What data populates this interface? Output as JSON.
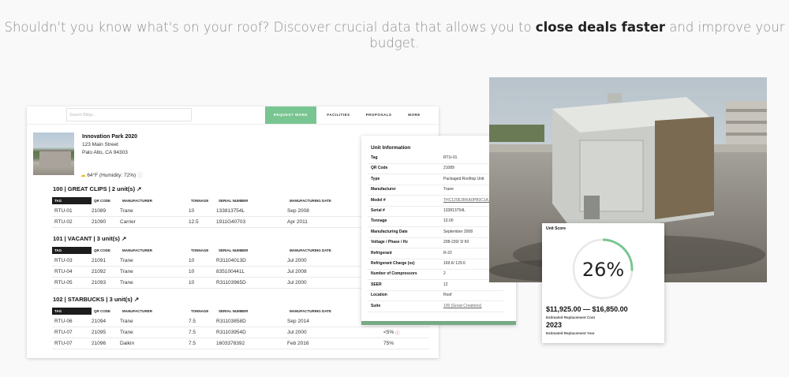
{
  "headline": {
    "pre": "Shouldn't you know what's on your roof? Discover crucial data that allows you to ",
    "bold": "close deals faster",
    "post": " and improve your budget."
  },
  "app": {
    "search_placeholder": "Search Bldgs...",
    "nav": [
      "REQUEST WORK",
      "FACILITIES",
      "PROPOSALS",
      "MORE"
    ],
    "building": {
      "name": "Innovation Park 2020",
      "address1": "123 Main Street",
      "address2": "Palo Alto, CA 94303",
      "weather": "64°F (Humidity: 72%)"
    },
    "table_headers": [
      "TAG",
      "QR CODE",
      "MANUFACTURER",
      "TONNAGE",
      "SERIAL NUMBER",
      "MANUFACTURING DATE"
    ],
    "groups": [
      {
        "title": "100 | GREAT CLIPS | 2 unit(s) ↗",
        "rows": [
          [
            "RTU-01",
            "21089",
            "Trane",
            "10",
            "133813754L",
            "Sep 2008",
            ""
          ],
          [
            "RTU-02",
            "21090",
            "Carrier",
            "12.5",
            "1911G40703",
            "Apr 2011",
            ""
          ]
        ]
      },
      {
        "title": "101 | VACANT | 3 unit(s) ↗",
        "rows": [
          [
            "RTU-03",
            "21091",
            "Trane",
            "10",
            "R31104013D",
            "Jul 2000",
            ""
          ],
          [
            "RTU-04",
            "21092",
            "Trane",
            "10",
            "835100441L",
            "Jul 2008",
            ""
          ],
          [
            "RTU-05",
            "21093",
            "Trane",
            "10",
            "R31103965D",
            "Jul 2000",
            ""
          ]
        ]
      },
      {
        "title": "102 | STARBUCKS | 3 unit(s) ↗",
        "rows": [
          [
            "RTU-06",
            "21094",
            "Trane",
            "7.5",
            "R31103858D",
            "Sep 2014",
            ""
          ],
          [
            "RTU-07",
            "21095",
            "Trane",
            "7.5",
            "R31103954D",
            "Jul 2000",
            "<5%"
          ],
          [
            "RTU-07",
            "21096",
            "Daikin",
            "7.5",
            "1603378392",
            "Feb 2016",
            "75%"
          ]
        ]
      }
    ]
  },
  "unit_info": {
    "title": "Unit Information",
    "rows": [
      [
        "Tag",
        "RTU-01"
      ],
      [
        "QR Code",
        "21089"
      ],
      [
        "Type",
        "Packaged Rooftop Unit"
      ],
      [
        "Manufacturer",
        "Trane"
      ],
      [
        "Model #",
        "THC120E3RKA0PB0C1A1A0"
      ],
      [
        "Serial #",
        "133813754L"
      ],
      [
        "Tonnage",
        "10.00"
      ],
      [
        "Manufacturing Date",
        "September 2008"
      ],
      [
        "Voltage / Phase / Hz",
        "208-230/ 3/ 60"
      ],
      [
        "Refrigerant",
        "R-22"
      ],
      [
        "Refrigerant Charge (oz)",
        "169.6/ 129.6"
      ],
      [
        "Number of Compressors",
        "2"
      ],
      [
        "SEER",
        "12"
      ],
      [
        "Location",
        "Roof"
      ],
      [
        "Suite",
        "100 (Great Creations)"
      ]
    ]
  },
  "score": {
    "title": "Unit Score",
    "percent_label": "26%",
    "percent_value": 0.26,
    "range": "$11,925.00 — $16,850.00",
    "range_label": "Estimated Replacement Cost",
    "year": "2023",
    "year_label": "Estimated Replacement Year",
    "accent": "#79c591"
  }
}
